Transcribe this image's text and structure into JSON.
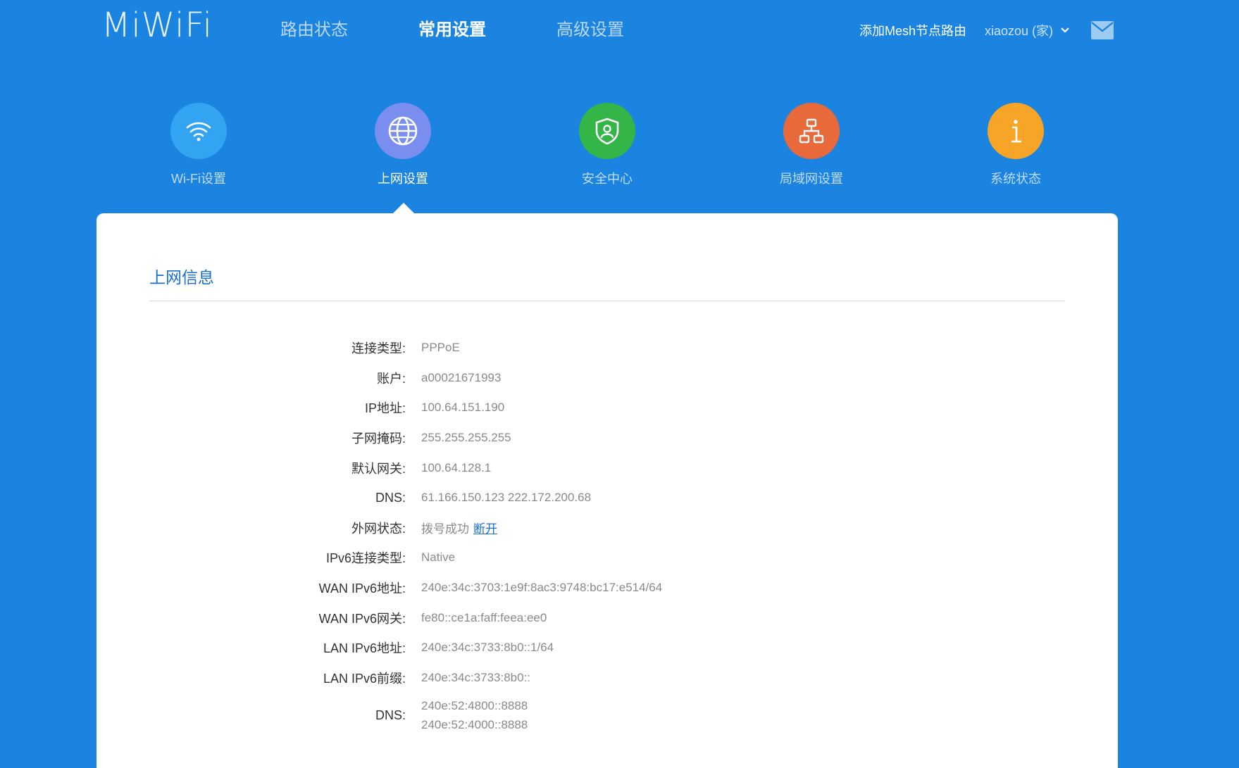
{
  "header": {
    "logo": "MiWiFi",
    "nav": [
      {
        "label": "路由状态",
        "active": false
      },
      {
        "label": "常用设置",
        "active": true
      },
      {
        "label": "高级设置",
        "active": false
      }
    ],
    "mesh_link": "添加Mesh节点路由",
    "user": "xiaozou (家)",
    "chevron_icon": "chevron-down-icon",
    "mail_icon": "mail-icon"
  },
  "tabs": [
    {
      "label": "Wi-Fi设置",
      "icon": "wifi-icon",
      "color": "#33a4f2",
      "active": false
    },
    {
      "label": "上网设置",
      "icon": "globe-icon",
      "color": "#7a8ef0",
      "active": true
    },
    {
      "label": "安全中心",
      "icon": "shield-icon",
      "color": "#33b548",
      "active": false
    },
    {
      "label": "局域网设置",
      "icon": "network-icon",
      "color": "#e8693a",
      "active": false
    },
    {
      "label": "系统状态",
      "icon": "info-icon",
      "color": "#f7a526",
      "active": false
    }
  ],
  "main": {
    "section_title": "上网信息",
    "rows": [
      {
        "key": "连接类型:",
        "value": "PPPoE"
      },
      {
        "key": "账户:",
        "value": "a00021671993"
      },
      {
        "key": "IP地址:",
        "value": "100.64.151.190"
      },
      {
        "key": "子网掩码:",
        "value": "255.255.255.255"
      },
      {
        "key": "默认网关:",
        "value": "100.64.128.1"
      },
      {
        "key": "DNS:",
        "value": "61.166.150.123 222.172.200.68"
      },
      {
        "key": "外网状态:",
        "value": "拨号成功",
        "link": "断开"
      },
      {
        "key": "IPv6连接类型:",
        "value": "Native"
      },
      {
        "key": "WAN IPv6地址:",
        "value": "240e:34c:3703:1e9f:8ac3:9748:bc17:e514/64"
      },
      {
        "key": "WAN IPv6网关:",
        "value": "fe80::ce1a:faff:feea:ee0"
      },
      {
        "key": "LAN IPv6地址:",
        "value": "240e:34c:3733:8b0::1/64"
      },
      {
        "key": "LAN IPv6前缀:",
        "value": "240e:34c:3733:8b0::"
      }
    ],
    "dns6": {
      "key": "DNS:",
      "values": [
        "240e:52:4800::8888",
        "240e:52:4000::8888"
      ]
    }
  }
}
